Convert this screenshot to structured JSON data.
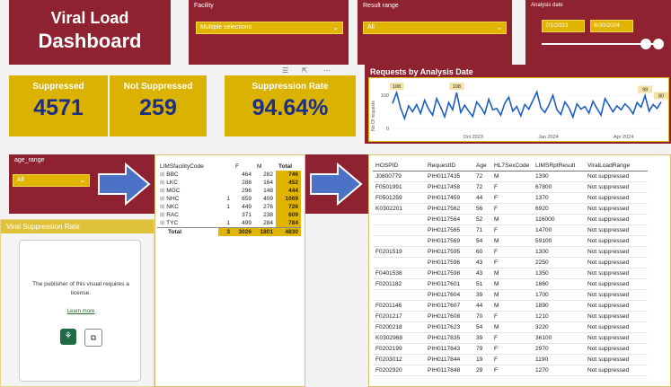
{
  "title": {
    "line1": "Viral Load",
    "line2": "Dashboard"
  },
  "slicers": {
    "facility": {
      "label": "Facility",
      "value": "Multiple selections"
    },
    "result_range": {
      "label": "Result range",
      "value": "All"
    },
    "analysis_date": {
      "label": "Analysis date",
      "start": "7/1/2023",
      "end": "6/30/2024"
    },
    "age_range": {
      "label": "age_range",
      "value": "All"
    }
  },
  "kpis": [
    {
      "label": "Suppressed",
      "value": "4571"
    },
    {
      "label": "Not Suppressed",
      "value": "259"
    },
    {
      "label": "Suppression Rate",
      "value": "94.64%"
    }
  ],
  "chart_data": {
    "type": "line",
    "title": "Requests by Analysis Date",
    "ylabel": "No Of requests",
    "x_ticks": [
      "Oct 2023",
      "Jan 2024",
      "Apr 2024"
    ],
    "y_ticks": [
      "0",
      "100"
    ],
    "ylim": [
      0,
      130
    ],
    "data_labels": [
      "108",
      "108",
      "99",
      "80"
    ],
    "color": "#1f5fc1",
    "series": [
      {
        "values": [
          75,
          108,
          62,
          30,
          68,
          50,
          72,
          45,
          85,
          58,
          40,
          90,
          64,
          35,
          78,
          56,
          108,
          48,
          70,
          52,
          36,
          80,
          64,
          44,
          88,
          56,
          60,
          40,
          76,
          94,
          52,
          66,
          38,
          72,
          58,
          84,
          110,
          62,
          48,
          70,
          100,
          56,
          42,
          80,
          62,
          34,
          74,
          58,
          66,
          46,
          82,
          60,
          40,
          90,
          70,
          50,
          68,
          56,
          74,
          62,
          44,
          78,
          64,
          99,
          52,
          72,
          60,
          80
        ]
      }
    ]
  },
  "vsr_panel": {
    "title": "Viral Suppression Rate",
    "message": "The publisher of this visual requires a license.",
    "learn_more": "Learn more"
  },
  "matrix": {
    "headers": [
      "LIMSfacilityCode",
      "F",
      "M",
      "Total"
    ],
    "rows": [
      {
        "code": "BBC",
        "u": "",
        "f": "464",
        "m": "282",
        "t": "746"
      },
      {
        "code": "LKC",
        "u": "",
        "f": "288",
        "m": "164",
        "t": "452"
      },
      {
        "code": "MGC",
        "u": "",
        "f": "296",
        "m": "148",
        "t": "444"
      },
      {
        "code": "NHC",
        "u": "1",
        "f": "659",
        "m": "409",
        "t": "1069"
      },
      {
        "code": "NKC",
        "u": "1",
        "f": "449",
        "m": "276",
        "t": "726"
      },
      {
        "code": "RAC",
        "u": "",
        "f": "371",
        "m": "238",
        "t": "609"
      },
      {
        "code": "TYC",
        "u": "1",
        "f": "499",
        "m": "284",
        "t": "784"
      }
    ],
    "total": {
      "label": "Total",
      "u": "3",
      "f": "3026",
      "m": "1801",
      "t": "4830"
    }
  },
  "detail_table": {
    "headers": [
      "HOSPID",
      "RequestID",
      "Age",
      "HL7SexCode",
      "LIMSRptResult",
      "ViralLoadRange"
    ],
    "rows": [
      [
        "J0800779",
        "PIH0117435",
        "72",
        "M",
        "1390",
        "Not suppressed"
      ],
      [
        "F0501991",
        "PIH0117458",
        "72",
        "F",
        "67800",
        "Not suppressed"
      ],
      [
        "F0501259",
        "PIH0117459",
        "44",
        "F",
        "1370",
        "Not suppressed"
      ],
      [
        "K0302201",
        "PIH0117562",
        "56",
        "F",
        "6920",
        "Not suppressed"
      ],
      [
        "",
        "PIH0117564",
        "52",
        "M",
        "116000",
        "Not suppressed"
      ],
      [
        "",
        "PIH0117565",
        "71",
        "F",
        "14700",
        "Not suppressed"
      ],
      [
        "",
        "PIH0117569",
        "54",
        "M",
        "59100",
        "Not suppressed"
      ],
      [
        "F0201519",
        "PIH0117595",
        "60",
        "F",
        "1300",
        "Not suppressed"
      ],
      [
        "",
        "PIH0117596",
        "43",
        "F",
        "2250",
        "Not suppressed"
      ],
      [
        "F0401538",
        "PIH0117598",
        "43",
        "M",
        "1350",
        "Not suppressed"
      ],
      [
        "F0201182",
        "PIH0117601",
        "51",
        "M",
        "1660",
        "Not suppressed"
      ],
      [
        "",
        "PIH0117604",
        "39",
        "M",
        "1700",
        "Not suppressed"
      ],
      [
        "F0201146",
        "PIH0117607",
        "44",
        "M",
        "1890",
        "Not suppressed"
      ],
      [
        "F0201217",
        "PIH0117608",
        "70",
        "F",
        "1210",
        "Not suppressed"
      ],
      [
        "F0200218",
        "PIH0117623",
        "54",
        "M",
        "3220",
        "Not suppressed"
      ],
      [
        "K0302968",
        "PIH0117835",
        "39",
        "F",
        "36100",
        "Not suppressed"
      ],
      [
        "F0202199",
        "PIH0117843",
        "79",
        "F",
        "2970",
        "Not suppressed"
      ],
      [
        "F0203012",
        "PIH0117844",
        "19",
        "F",
        "1190",
        "Not suppressed"
      ],
      [
        "F0202920",
        "PIH0117848",
        "29",
        "F",
        "1270",
        "Not suppressed"
      ]
    ]
  }
}
